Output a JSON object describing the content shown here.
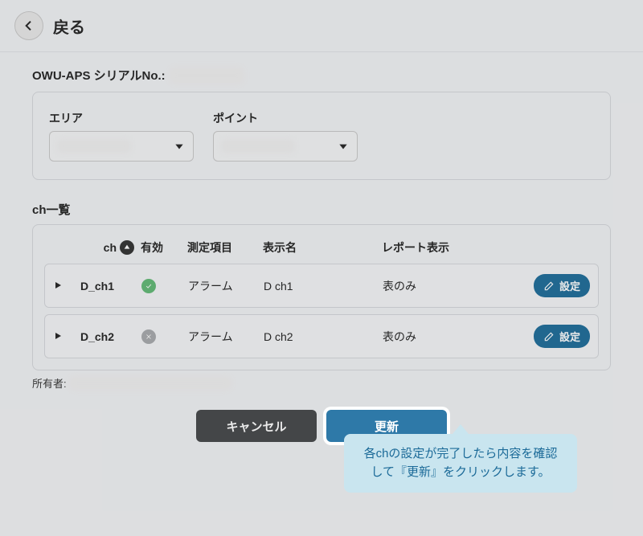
{
  "header": {
    "back_label": "戻る"
  },
  "serial": {
    "label": "OWU-APS シリアルNo.:"
  },
  "fields": {
    "area_label": "エリア",
    "point_label": "ポイント"
  },
  "ch_list": {
    "title": "ch一覧",
    "columns": {
      "ch": "ch",
      "enabled": "有効",
      "measurement": "測定項目",
      "display_name": "表示名",
      "report": "レポート表示"
    },
    "rows": [
      {
        "ch": "D_ch1",
        "enabled": true,
        "measurement": "アラーム",
        "display_name": "D ch1",
        "report": "表のみ"
      },
      {
        "ch": "D_ch2",
        "enabled": false,
        "measurement": "アラーム",
        "display_name": "D ch2",
        "report": "表のみ"
      }
    ],
    "settings_btn_label": "設定"
  },
  "owner_label": "所有者:",
  "buttons": {
    "cancel": "キャンセル",
    "update": "更新"
  },
  "tooltip": {
    "text": "各chの設定が完了したら内容を確認して『更新』をクリックします。"
  }
}
